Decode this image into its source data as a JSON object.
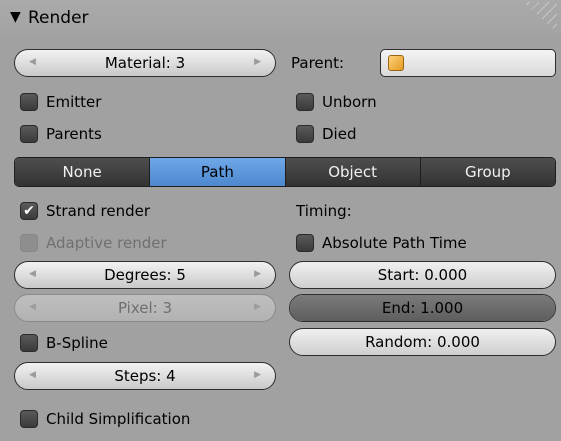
{
  "panel": {
    "title": "Render"
  },
  "material": {
    "label": "Material: 3"
  },
  "parent": {
    "label": "Parent:"
  },
  "left_checks": [
    {
      "label": "Emitter",
      "checked": false
    },
    {
      "label": "Parents",
      "checked": false
    }
  ],
  "right_checks": [
    {
      "label": "Unborn",
      "checked": false
    },
    {
      "label": "Died",
      "checked": false
    }
  ],
  "render_as": {
    "options": [
      "None",
      "Path",
      "Object",
      "Group"
    ],
    "selected": "Path"
  },
  "strand_render": {
    "label": "Strand render",
    "checked": true
  },
  "adaptive_render": {
    "label": "Adaptive render",
    "checked": false
  },
  "degrees": {
    "label": "Degrees: 5"
  },
  "pixel": {
    "label": "Pixel: 3"
  },
  "bspline": {
    "label": "B-Spline",
    "checked": false
  },
  "steps": {
    "label": "Steps: 4"
  },
  "child_simplification": {
    "label": "Child Simplification",
    "checked": false
  },
  "timing": {
    "label": "Timing:",
    "absolute": {
      "label": "Absolute Path Time",
      "checked": false
    },
    "start": {
      "label": "Start: 0.000",
      "fill": 0.0
    },
    "end": {
      "label": "End: 1.000",
      "fill": 1.0
    },
    "random": {
      "label": "Random: 0.000",
      "fill": 0.0
    }
  },
  "colors": {
    "panel_bg": "#a1a1a1",
    "active_segment": "#5a96dc",
    "segment_bg": "#3d3d3d"
  },
  "icons": {
    "collapse": "triangle-down-icon",
    "object": "cube-icon"
  }
}
